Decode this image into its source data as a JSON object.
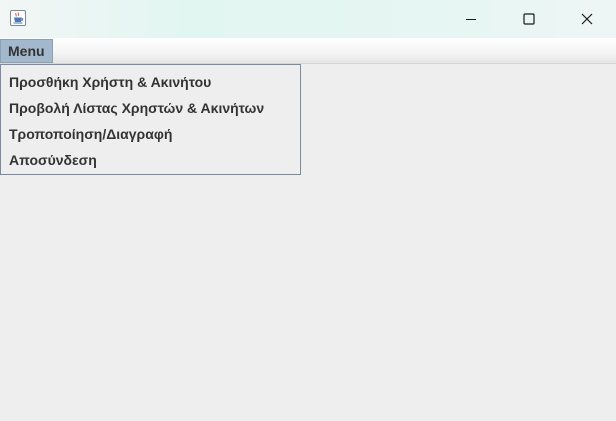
{
  "window": {
    "icon": "java-cup-icon",
    "controls": {
      "minimize": "minimize-icon",
      "maximize": "maximize-icon",
      "close": "close-icon"
    }
  },
  "menubar": {
    "menu_label": "Menu"
  },
  "menu": {
    "items": [
      {
        "label": "Προσθήκη Χρήστη & Ακινήτου"
      },
      {
        "label": "Προβολή Λίστας Χρηστών & Ακινήτων"
      },
      {
        "label": "Τροποποίηση/Διαγραφή"
      },
      {
        "label": "Αποσύνδεση"
      }
    ]
  },
  "colors": {
    "menu_highlight": "#a3b8cc",
    "popup_border": "#7a8aa3",
    "content_background": "#eeeeee"
  }
}
